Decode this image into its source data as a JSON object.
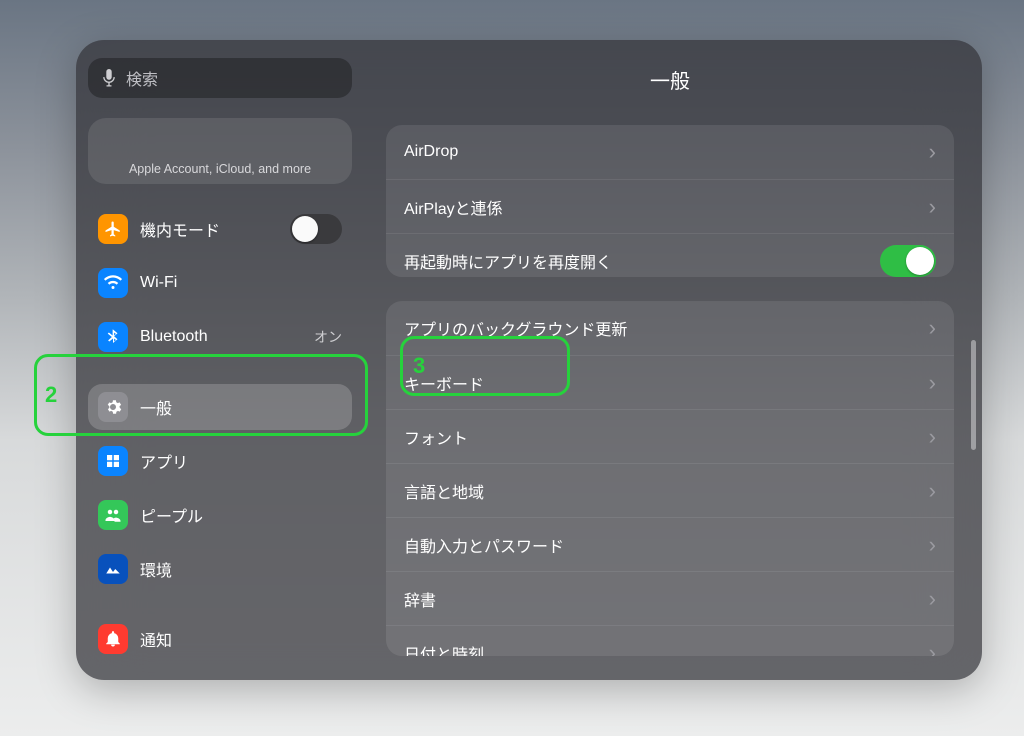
{
  "search": {
    "placeholder": "検索"
  },
  "account": {
    "subtitle": "Apple Account, iCloud, and more"
  },
  "sidebar": {
    "items": [
      {
        "label": "機内モード",
        "icon": "airplane",
        "color": "ic-orange",
        "type": "toggle"
      },
      {
        "label": "Wi-Fi",
        "icon": "wifi",
        "color": "ic-blue",
        "type": "value",
        "value": ""
      },
      {
        "label": "Bluetooth",
        "icon": "bluetooth",
        "color": "ic-blue",
        "type": "value",
        "value": "オン"
      },
      {
        "label": "一般",
        "icon": "gear",
        "color": "ic-grey",
        "type": "nav",
        "selected": true
      },
      {
        "label": "アプリ",
        "icon": "apps",
        "color": "ic-blue",
        "type": "nav"
      },
      {
        "label": "ピープル",
        "icon": "people",
        "color": "ic-green",
        "type": "nav"
      },
      {
        "label": "環境",
        "icon": "env",
        "color": "ic-navy",
        "type": "nav"
      },
      {
        "label": "通知",
        "icon": "bell",
        "color": "ic-red",
        "type": "nav"
      }
    ]
  },
  "main": {
    "title": "一般",
    "group1": [
      {
        "label": "AirDrop",
        "type": "nav"
      },
      {
        "label": "AirPlayと連係",
        "type": "nav"
      },
      {
        "label": "再起動時にアプリを再度開く",
        "type": "toggle_on"
      }
    ],
    "group2": [
      {
        "label": "アプリのバックグラウンド更新",
        "type": "nav"
      },
      {
        "label": "キーボード",
        "type": "nav"
      },
      {
        "label": "フォント",
        "type": "nav"
      },
      {
        "label": "言語と地域",
        "type": "nav"
      },
      {
        "label": "自動入力とパスワード",
        "type": "nav"
      },
      {
        "label": "辞書",
        "type": "nav"
      },
      {
        "label": "日付と時刻",
        "type": "nav"
      }
    ]
  },
  "annotations": {
    "a2": "2",
    "a3": "3"
  }
}
